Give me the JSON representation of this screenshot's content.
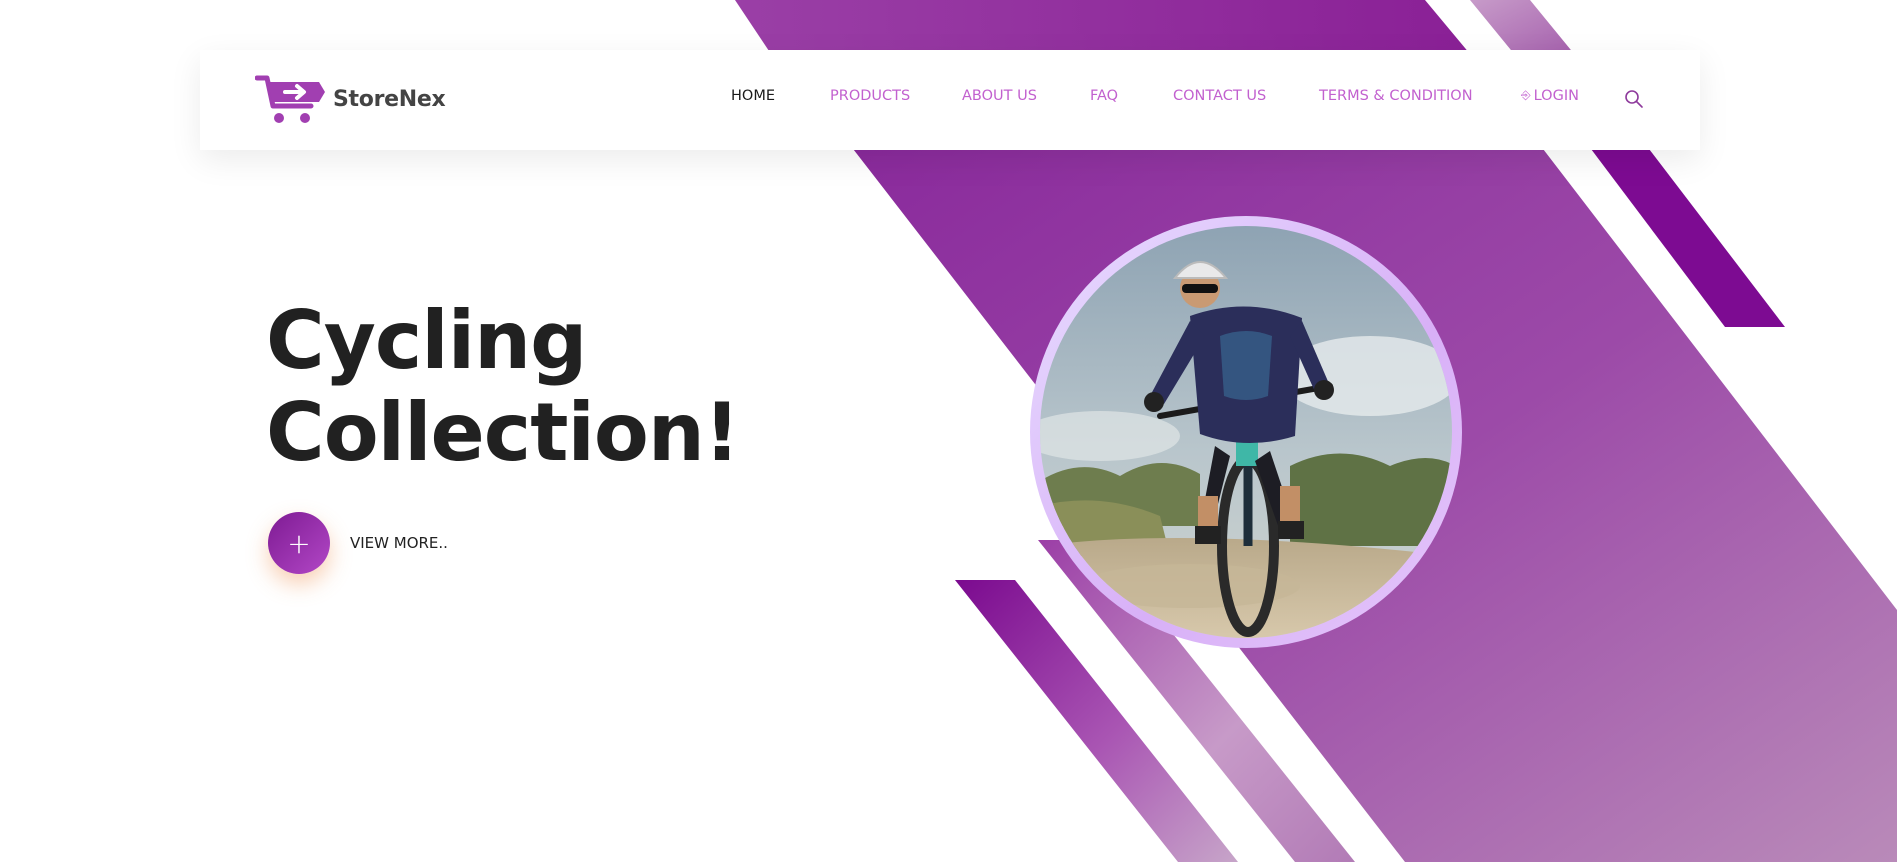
{
  "brand": {
    "name": "StoreNex",
    "logo_icon": "shopping-cart-icon"
  },
  "nav": {
    "items": [
      {
        "label": "HOME",
        "active": true
      },
      {
        "label": "PRODUCTS",
        "active": false
      },
      {
        "label": "ABOUT US",
        "active": false
      },
      {
        "label": "FAQ",
        "active": false
      },
      {
        "label": "CONTACT US",
        "active": false
      },
      {
        "label": "TERMS & CONDITION",
        "active": false
      }
    ],
    "login_label": "LOGIN",
    "login_icon": "login-icon",
    "search_icon": "search-icon"
  },
  "hero": {
    "title_line1": "Cycling",
    "title_line2": "Collection!",
    "cta_icon": "plus-icon",
    "cta_label": "VIEW MORE.."
  },
  "colors": {
    "accent": "#c261cf",
    "brand_purple": "#8e2a9e",
    "deep_purple": "#7a0490",
    "title_dark": "#212121"
  }
}
